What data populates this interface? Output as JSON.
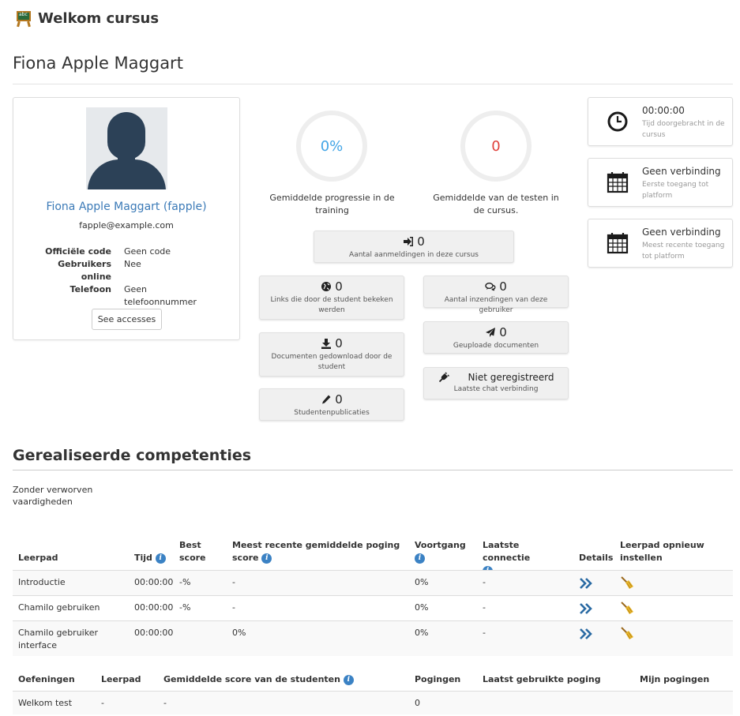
{
  "course": {
    "title": "Welkom cursus",
    "icon": "chalkboard-icon"
  },
  "student": {
    "name": "Fiona Apple Maggart",
    "display_name": "Fiona Apple Maggart (fapple)",
    "email": "fapple@example.com",
    "info": [
      {
        "key": "Officiële code",
        "value": "Geen code"
      },
      {
        "key": "Gebruikers online",
        "value": "Nee"
      },
      {
        "key": "Telefoon",
        "value": "Geen telefoonnummer"
      }
    ],
    "see_accesses": "See accesses"
  },
  "rings": [
    {
      "value": "0%",
      "label": "Gemiddelde progressie in de training",
      "color": "#42a5e6"
    },
    {
      "value": "0",
      "label": "Gemiddelde van de testen in de cursus.",
      "color": "#e0403a"
    }
  ],
  "stats": {
    "logins": {
      "value": "0",
      "label": "Aantal aanmeldingen in deze cursus",
      "icon": "sign-in-icon"
    },
    "links": {
      "value": "0",
      "label": "Links die door de student bekeken werden",
      "icon": "globe-icon"
    },
    "submissions": {
      "value": "0",
      "label": "Aantal inzendingen van deze gebruiker",
      "icon": "comments-icon"
    },
    "uploads": {
      "value": "0",
      "label": "Geuploade documenten",
      "icon": "paper-plane-icon"
    },
    "downloads": {
      "value": "0",
      "label": "Documenten gedownload door de student",
      "icon": "download-icon"
    },
    "chat": {
      "value": "Niet geregistreerd",
      "label": "Laatste chat verbinding",
      "icon": "plug-icon"
    },
    "publications": {
      "value": "0",
      "label": "Studentenpublicaties",
      "icon": "pencil-icon"
    }
  },
  "side": [
    {
      "title": "00:00:00",
      "sub": "Tijd doorgebracht in de cursus",
      "icon": "clock-icon"
    },
    {
      "title": "Geen verbinding",
      "sub": "Eerste toegang tot platform",
      "icon": "calendar-icon"
    },
    {
      "title": "Geen verbinding",
      "sub": "Meest recente toegang tot platform",
      "icon": "calendar-icon"
    }
  ],
  "competences": {
    "title": "Gerealiseerde competenties",
    "empty": "Zonder verworven vaardigheden"
  },
  "lp_table": {
    "headers": {
      "leerpad": "Leerpad",
      "tijd": "Tijd",
      "best": "Best score",
      "recent": "Meest recente gemiddelde poging score",
      "voortgang": "Voortgang",
      "laatste": "Laatste connectie",
      "details": "Details",
      "reset": "Leerpad opnieuw instellen"
    },
    "rows": [
      {
        "name": "Introductie",
        "time": "00:00:00",
        "best": "-%",
        "recent": "-",
        "progress": "0%",
        "last": "-"
      },
      {
        "name": "Chamilo gebruiken",
        "time": "00:00:00",
        "best": "-%",
        "recent": "-",
        "progress": "0%",
        "last": "-"
      },
      {
        "name": "Chamilo gebruiker interface",
        "time": "00:00:00",
        "best": "",
        "recent": "0%",
        "progress": "0%",
        "last": "-"
      }
    ]
  },
  "ex_table": {
    "headers": {
      "oef": "Oefeningen",
      "leerpad": "Leerpad",
      "gem": "Gemiddelde score van de studenten",
      "pog": "Pogingen",
      "laatst": "Laatst gebruikte poging",
      "mijn": "Mijn pogingen"
    },
    "rows": [
      {
        "name": "Welkom test",
        "lp": "-",
        "avg": "-",
        "attempts": "0",
        "last": "",
        "mine": ""
      }
    ]
  }
}
